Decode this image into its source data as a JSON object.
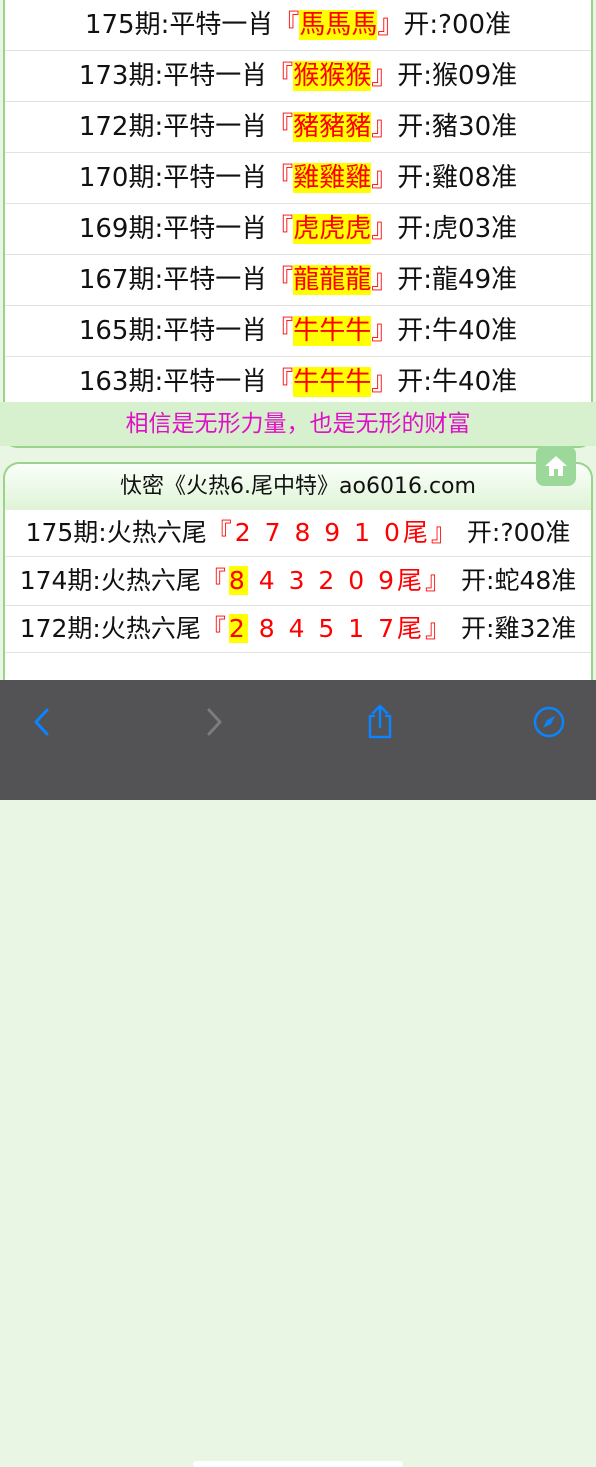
{
  "section1": {
    "rows": [
      {
        "label": "175期:平特一肖",
        "lq": "『",
        "zodiac": "馬馬馬",
        "rq": "』",
        "result": "开:?00准"
      },
      {
        "label": "173期:平特一肖",
        "lq": "『",
        "zodiac": "猴猴猴",
        "rq": "』",
        "result": "开:猴09准"
      },
      {
        "label": "172期:平特一肖",
        "lq": "『",
        "zodiac": "豬豬豬",
        "rq": "』",
        "result": "开:豬30准"
      },
      {
        "label": "170期:平特一肖",
        "lq": "『",
        "zodiac": "雞雞雞",
        "rq": "』",
        "result": "开:雞08准"
      },
      {
        "label": "169期:平特一肖",
        "lq": "『",
        "zodiac": "虎虎虎",
        "rq": "』",
        "result": "开:虎03准"
      },
      {
        "label": "167期:平特一肖",
        "lq": "『",
        "zodiac": "龍龍龍",
        "rq": "』",
        "result": "开:龍49准"
      },
      {
        "label": "165期:平特一肖",
        "lq": "『",
        "zodiac": "牛牛牛",
        "rq": "』",
        "result": "开:牛40准"
      },
      {
        "label": "163期:平特一肖",
        "lq": "『",
        "zodiac": "牛牛牛",
        "rq": "』",
        "result": "开:牛40准"
      }
    ],
    "slogan": "相信是无形力量，也是无形的财富"
  },
  "section2": {
    "title": "忲密《火热6.尾中特》ao6016.com",
    "rows": [
      {
        "label": "175期:火热六尾",
        "lq": "『",
        "nums_pre": "",
        "nums_hl": "",
        "nums_post": "2 7 8 9 1 0尾",
        "rq": "』",
        "result": "开:?00准"
      },
      {
        "label": "174期:火热六尾",
        "lq": "『",
        "nums_pre": "",
        "nums_hl": "8",
        "nums_post": " 4 3 2 0 9尾",
        "rq": "』",
        "result": "开:蛇48准"
      },
      {
        "label": "172期:火热六尾",
        "lq": "『",
        "nums_pre": "",
        "nums_hl": "2",
        "nums_post": " 8 4 5 1 7尾",
        "rq": "』",
        "result": "开:雞32准"
      }
    ]
  },
  "toolbar": {
    "icons": [
      "chevron-left-icon",
      "chevron-right-icon",
      "share-icon",
      "compass-icon"
    ],
    "accent": "#0a84ff"
  }
}
